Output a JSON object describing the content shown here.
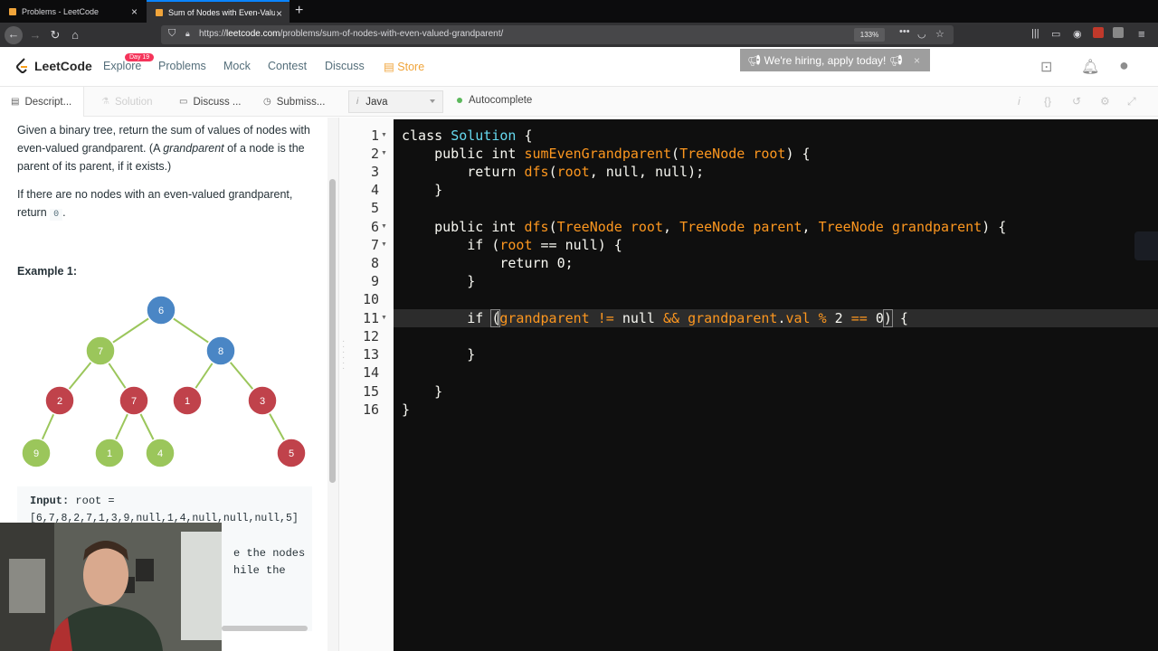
{
  "browser": {
    "tabs": [
      {
        "title": "Problems - LeetCode"
      },
      {
        "title": "Sum of Nodes with Even-Valued"
      }
    ],
    "url_prefix": "https://",
    "url_host": "leetcode.com",
    "url_path": "/problems/sum-of-nodes-with-even-valued-grandparent/",
    "zoom": "133%"
  },
  "header": {
    "logo_text": "LeetCode",
    "day_badge": "Day 19",
    "nav": [
      "Explore",
      "Problems",
      "Mock",
      "Contest",
      "Discuss",
      "Store"
    ],
    "hiring": "We're hiring, apply today!"
  },
  "subtabs": {
    "description": "Descript...",
    "solution": "Solution",
    "discuss": "Discuss ...",
    "submissions": "Submiss...",
    "language": "Java",
    "autocomplete": "Autocomplete"
  },
  "problem": {
    "p1_a": "Given a binary tree, return the sum of values of nodes with even-valued grandparent.  (A ",
    "p1_em": "grandparent",
    "p1_b": " of a node is the parent of its parent, if it exists.)",
    "p2_a": "If there are no nodes with an even-valued grandparent, return ",
    "p2_code": "0",
    "p2_b": ".",
    "example_title": "Example 1:",
    "input_label": "Input:",
    "input_line1": " root =",
    "input_line2": "[6,7,8,2,7,1,3,9,null,1,4,null,null,null,5]",
    "partial_line1": "e the nodes",
    "partial_line2": "hile the"
  },
  "tree": {
    "nodes": [
      {
        "value": "6",
        "color": "#4a86c5"
      },
      {
        "value": "7",
        "color": "#9bc65b"
      },
      {
        "value": "8",
        "color": "#4a86c5"
      },
      {
        "value": "2",
        "color": "#c0424b"
      },
      {
        "value": "7",
        "color": "#c0424b"
      },
      {
        "value": "1",
        "color": "#c0424b"
      },
      {
        "value": "3",
        "color": "#c0424b"
      },
      {
        "value": "9",
        "color": "#9bc65b"
      },
      {
        "value": "1",
        "color": "#9bc65b"
      },
      {
        "value": "4",
        "color": "#9bc65b"
      },
      {
        "value": "5",
        "color": "#c0424b"
      }
    ],
    "edge_color": "#9bc65b"
  },
  "editor": {
    "line_numbers": [
      "1",
      "2",
      "3",
      "4",
      "5",
      "6",
      "7",
      "8",
      "9",
      "10",
      "11",
      "12",
      "13",
      "14",
      "15",
      "16"
    ]
  }
}
